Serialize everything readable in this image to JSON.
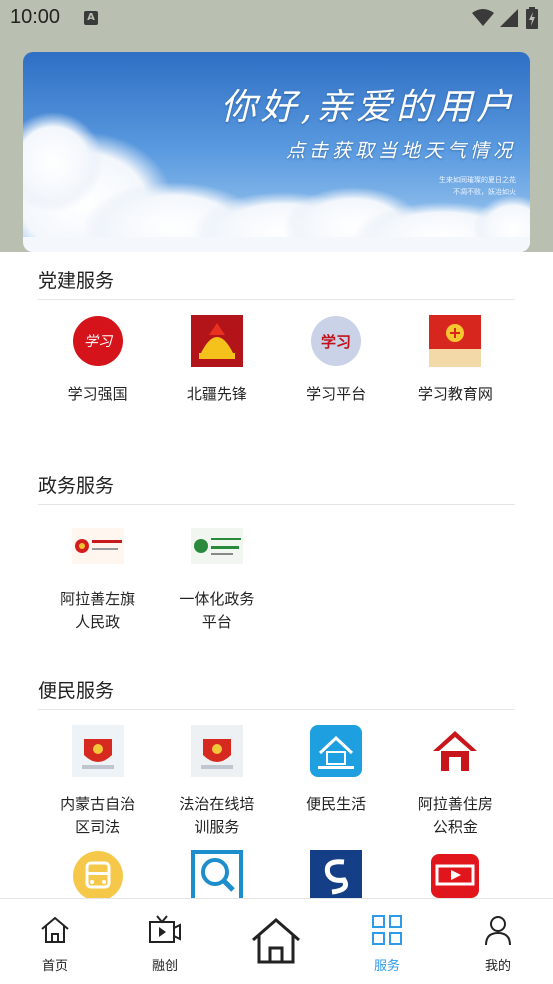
{
  "status_bar": {
    "time": "10:00",
    "notification_icon": "A"
  },
  "banner": {
    "greeting": "你好,亲爱的用户",
    "subtitle": "点击获取当地天气情况",
    "fine_print_1": "生来如同璀璨的夏日之花",
    "fine_print_2": "不凋不败，妖冶如火"
  },
  "sections": [
    {
      "title": "党建服务",
      "items": [
        {
          "label": "学习强国",
          "icon": "xuexi-qiangguo-icon"
        },
        {
          "label": "北疆先锋",
          "icon": "beijiang-xianfeng-icon"
        },
        {
          "label": "学习平台",
          "icon": "xuexi-pingtai-icon"
        },
        {
          "label": "学习教育网",
          "icon": "xuexi-jiaoyu-icon"
        }
      ]
    },
    {
      "title": "政务服务",
      "items": [
        {
          "label": "阿拉善左旗人民政",
          "icon": "gov-emblem-icon"
        },
        {
          "label": "一体化政务平台",
          "icon": "gov-platform-icon"
        }
      ]
    },
    {
      "title": "便民服务",
      "items": [
        {
          "label": "内蒙古自治区司法",
          "icon": "justice-emblem-icon"
        },
        {
          "label": "法治在线培训服务",
          "icon": "law-training-icon"
        },
        {
          "label": "便民生活",
          "icon": "house-icon"
        },
        {
          "label": "阿拉善住房公积金",
          "icon": "housing-fund-icon"
        },
        {
          "label": "",
          "icon": "bus-icon"
        },
        {
          "label": "",
          "icon": "search-app-icon"
        },
        {
          "label": "",
          "icon": "s-logo-icon"
        },
        {
          "label": "",
          "icon": "movie-icon"
        }
      ]
    }
  ],
  "tabbar": {
    "active_color": "#2f9ae8",
    "tabs": [
      {
        "label": "首页",
        "icon": "home-icon"
      },
      {
        "label": "融创",
        "icon": "tv-icon"
      },
      {
        "label": "",
        "icon": "home-big-icon"
      },
      {
        "label": "服务",
        "icon": "grid-icon"
      },
      {
        "label": "我的",
        "icon": "person-icon"
      }
    ]
  }
}
